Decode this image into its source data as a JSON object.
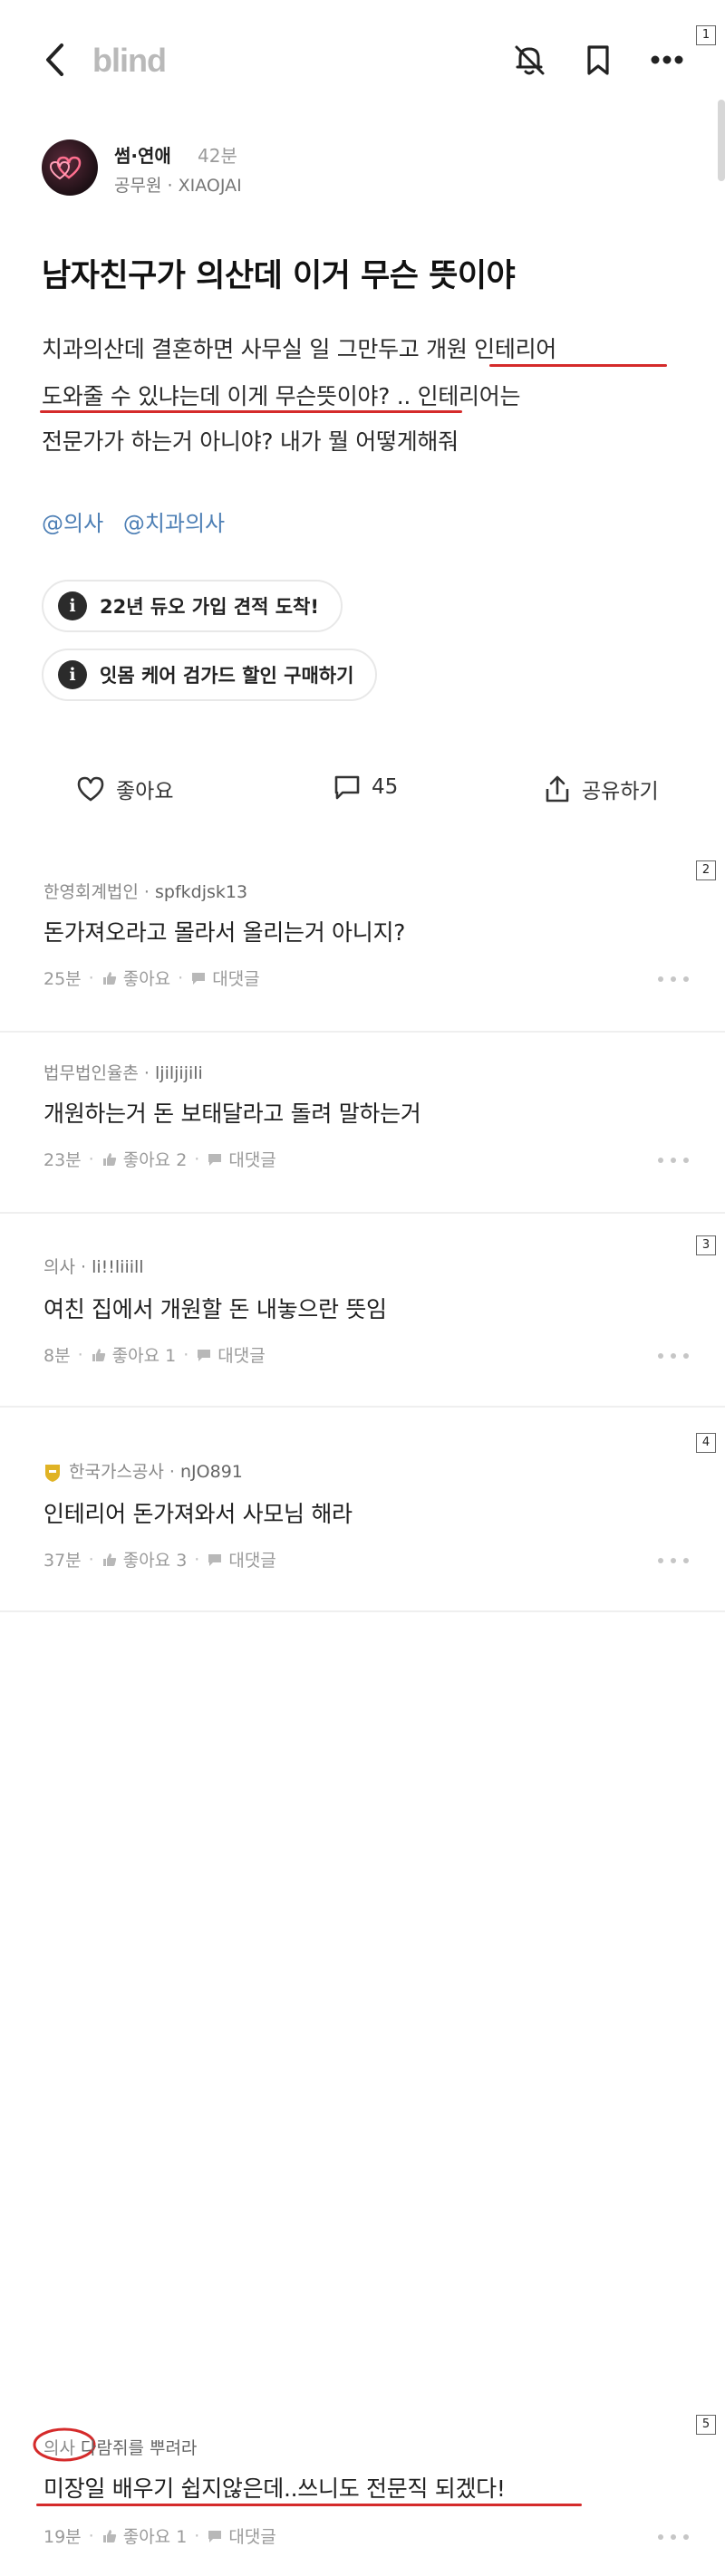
{
  "header": {
    "logo": "blind",
    "back_icon": "chevron-left-icon",
    "bell_icon": "bell-off-icon",
    "bookmark_icon": "bookmark-icon",
    "more_icon": "more-horizontal-icon"
  },
  "page_badges": [
    "1",
    "2",
    "3",
    "4",
    "5"
  ],
  "post": {
    "community": "썸·연애",
    "time": "42분",
    "author_job": "공무원",
    "author_company": "XIAOJAI",
    "title": "남자친구가 의산데 이거 무슨 뜻이야",
    "body_lines": [
      "치과의산데 결혼하면 사무실 일 그만두고 개원 인테리어",
      "도와줄 수 있냐는데 이게 무슨뜻이야? .. 인테리어는",
      "전문가가  하는거 아니야? 내가 뭘 어떻게해줘"
    ],
    "tags": [
      "@의사",
      "@치과의사"
    ],
    "chips": [
      "22년 듀오 가입 견적 도착!",
      "잇몸 케어 검가드 할인 구매하기"
    ],
    "actions": {
      "like_label": "좋아요",
      "comment_count": "45",
      "share_label": "공유하기"
    }
  },
  "comments": [
    {
      "company": "한영회계법인",
      "nick": "spfkdjsk13",
      "text": "돈가져오라고 몰라서 올리는거 아니지?",
      "time": "25분",
      "like": "좋아요",
      "reply": "대댓글"
    },
    {
      "company": "법무법인율촌",
      "nick": "ljiljijili",
      "text": "개원하는거 돈 보태달라고 돌려 말하는거",
      "time": "23분",
      "like": "좋아요 2",
      "reply": "대댓글"
    },
    {
      "company": "의사",
      "nick": "li!!liiill",
      "text": "여친 집에서 개원할 돈 내놓으란 뜻임",
      "time": "8분",
      "like": "좋아요 1",
      "reply": "대댓글"
    },
    {
      "company": "한국가스공사",
      "nick": "nJO891",
      "text": "인테리어 돈가져와서 사모님 해라",
      "time": "37분",
      "like": "좋아요 3",
      "reply": "대댓글"
    },
    {
      "company": "의사",
      "nick": "다람쥐를 뿌려라",
      "text": "미장일 배우기 쉽지않은데..쓰니도 전문직 되겠다!",
      "time": "19분",
      "like": "좋아요 1",
      "reply": "대댓글"
    }
  ],
  "colors": {
    "annotation_red": "#d52b2b",
    "tag_blue": "#4d7fb5",
    "logo_gray": "#b9b9b9"
  }
}
